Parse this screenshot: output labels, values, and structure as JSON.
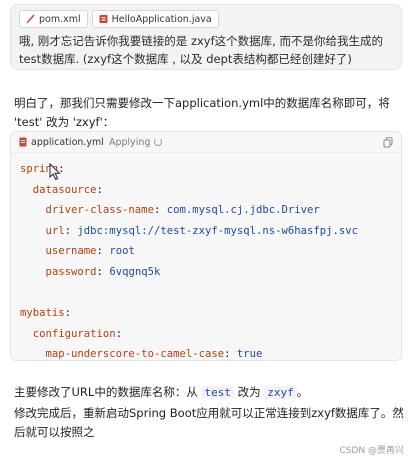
{
  "user_message": {
    "attachments": [
      {
        "name": "pom.xml",
        "icon": "xml-file-icon",
        "color": "#c04a4a"
      },
      {
        "name": "HelloApplication.java",
        "icon": "java-file-icon",
        "color": "#d04030"
      }
    ],
    "text": "哦, 刚才忘记告诉你我要链接的是 zxyf这个数据库, 而不是你给我生成的test数据库. (zxyf这个数据库 , 以及 dept表结构都已经创建好了)"
  },
  "assistant": {
    "intro": "明白了，那我们只需要修改一下application.yml中的数据库名称即可，将 'test' 改为 'zxyf'：",
    "code_block": {
      "filename": "application.yml",
      "status": "Applying",
      "lines": [
        {
          "indent": "",
          "key": "spring",
          "value": ""
        },
        {
          "indent": "  ",
          "key": "datasource",
          "value": ""
        },
        {
          "indent": "    ",
          "key": "driver-class-name",
          "value": "com.mysql.cj.jdbc.Driver"
        },
        {
          "indent": "    ",
          "key": "url",
          "value": "jdbc:mysql://test-zxyf-mysql.ns-w6hasfpj.svc"
        },
        {
          "indent": "    ",
          "key": "username",
          "value": "root"
        },
        {
          "indent": "    ",
          "key": "password",
          "value": "6vqgnq5k"
        },
        {
          "indent": "",
          "key": "",
          "value": ""
        },
        {
          "indent": "",
          "key": "mybatis",
          "value": ""
        },
        {
          "indent": "  ",
          "key": "configuration",
          "value": ""
        },
        {
          "indent": "    ",
          "key": "map-underscore-to-camel-case",
          "value": "true"
        }
      ]
    },
    "summary_prefix": "主要修改了URL中的数据库名称：从",
    "summary_from": "test",
    "summary_mid": "改为",
    "summary_to": "zxyf",
    "summary_suffix": "。",
    "followup": "修改完成后，重新启动Spring Boot应用就可以正常连接到zxyf数据库了。然后就可以按照之"
  },
  "watermark": "CSDN @贾再兴"
}
